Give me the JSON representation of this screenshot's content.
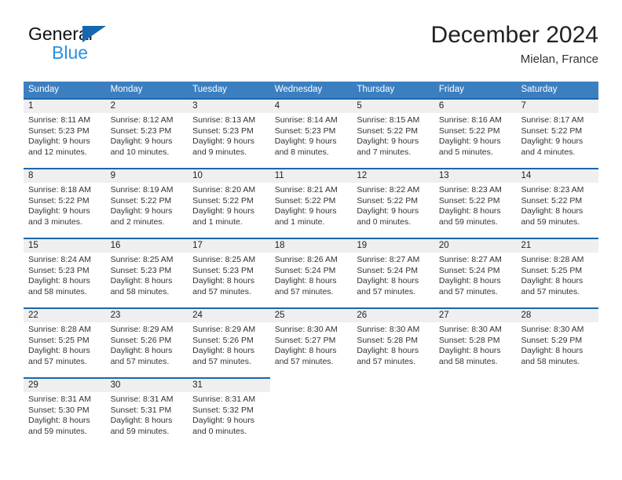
{
  "brand": {
    "line1": "General",
    "line2": "Blue",
    "triangle_color": "#1667b0",
    "blue_text_color": "#2a8fe0"
  },
  "header": {
    "title": "December 2024",
    "location": "Mielan, France"
  },
  "theme": {
    "header_bg": "#3c7fc0",
    "row_divider": "#1c66ab",
    "day_band_bg": "#efefef"
  },
  "weekdays": [
    "Sunday",
    "Monday",
    "Tuesday",
    "Wednesday",
    "Thursday",
    "Friday",
    "Saturday"
  ],
  "weeks": [
    [
      {
        "day": "1",
        "lines": [
          "Sunrise: 8:11 AM",
          "Sunset: 5:23 PM",
          "Daylight: 9 hours",
          "and 12 minutes."
        ]
      },
      {
        "day": "2",
        "lines": [
          "Sunrise: 8:12 AM",
          "Sunset: 5:23 PM",
          "Daylight: 9 hours",
          "and 10 minutes."
        ]
      },
      {
        "day": "3",
        "lines": [
          "Sunrise: 8:13 AM",
          "Sunset: 5:23 PM",
          "Daylight: 9 hours",
          "and 9 minutes."
        ]
      },
      {
        "day": "4",
        "lines": [
          "Sunrise: 8:14 AM",
          "Sunset: 5:23 PM",
          "Daylight: 9 hours",
          "and 8 minutes."
        ]
      },
      {
        "day": "5",
        "lines": [
          "Sunrise: 8:15 AM",
          "Sunset: 5:22 PM",
          "Daylight: 9 hours",
          "and 7 minutes."
        ]
      },
      {
        "day": "6",
        "lines": [
          "Sunrise: 8:16 AM",
          "Sunset: 5:22 PM",
          "Daylight: 9 hours",
          "and 5 minutes."
        ]
      },
      {
        "day": "7",
        "lines": [
          "Sunrise: 8:17 AM",
          "Sunset: 5:22 PM",
          "Daylight: 9 hours",
          "and 4 minutes."
        ]
      }
    ],
    [
      {
        "day": "8",
        "lines": [
          "Sunrise: 8:18 AM",
          "Sunset: 5:22 PM",
          "Daylight: 9 hours",
          "and 3 minutes."
        ]
      },
      {
        "day": "9",
        "lines": [
          "Sunrise: 8:19 AM",
          "Sunset: 5:22 PM",
          "Daylight: 9 hours",
          "and 2 minutes."
        ]
      },
      {
        "day": "10",
        "lines": [
          "Sunrise: 8:20 AM",
          "Sunset: 5:22 PM",
          "Daylight: 9 hours",
          "and 1 minute."
        ]
      },
      {
        "day": "11",
        "lines": [
          "Sunrise: 8:21 AM",
          "Sunset: 5:22 PM",
          "Daylight: 9 hours",
          "and 1 minute."
        ]
      },
      {
        "day": "12",
        "lines": [
          "Sunrise: 8:22 AM",
          "Sunset: 5:22 PM",
          "Daylight: 9 hours",
          "and 0 minutes."
        ]
      },
      {
        "day": "13",
        "lines": [
          "Sunrise: 8:23 AM",
          "Sunset: 5:22 PM",
          "Daylight: 8 hours",
          "and 59 minutes."
        ]
      },
      {
        "day": "14",
        "lines": [
          "Sunrise: 8:23 AM",
          "Sunset: 5:22 PM",
          "Daylight: 8 hours",
          "and 59 minutes."
        ]
      }
    ],
    [
      {
        "day": "15",
        "lines": [
          "Sunrise: 8:24 AM",
          "Sunset: 5:23 PM",
          "Daylight: 8 hours",
          "and 58 minutes."
        ]
      },
      {
        "day": "16",
        "lines": [
          "Sunrise: 8:25 AM",
          "Sunset: 5:23 PM",
          "Daylight: 8 hours",
          "and 58 minutes."
        ]
      },
      {
        "day": "17",
        "lines": [
          "Sunrise: 8:25 AM",
          "Sunset: 5:23 PM",
          "Daylight: 8 hours",
          "and 57 minutes."
        ]
      },
      {
        "day": "18",
        "lines": [
          "Sunrise: 8:26 AM",
          "Sunset: 5:24 PM",
          "Daylight: 8 hours",
          "and 57 minutes."
        ]
      },
      {
        "day": "19",
        "lines": [
          "Sunrise: 8:27 AM",
          "Sunset: 5:24 PM",
          "Daylight: 8 hours",
          "and 57 minutes."
        ]
      },
      {
        "day": "20",
        "lines": [
          "Sunrise: 8:27 AM",
          "Sunset: 5:24 PM",
          "Daylight: 8 hours",
          "and 57 minutes."
        ]
      },
      {
        "day": "21",
        "lines": [
          "Sunrise: 8:28 AM",
          "Sunset: 5:25 PM",
          "Daylight: 8 hours",
          "and 57 minutes."
        ]
      }
    ],
    [
      {
        "day": "22",
        "lines": [
          "Sunrise: 8:28 AM",
          "Sunset: 5:25 PM",
          "Daylight: 8 hours",
          "and 57 minutes."
        ]
      },
      {
        "day": "23",
        "lines": [
          "Sunrise: 8:29 AM",
          "Sunset: 5:26 PM",
          "Daylight: 8 hours",
          "and 57 minutes."
        ]
      },
      {
        "day": "24",
        "lines": [
          "Sunrise: 8:29 AM",
          "Sunset: 5:26 PM",
          "Daylight: 8 hours",
          "and 57 minutes."
        ]
      },
      {
        "day": "25",
        "lines": [
          "Sunrise: 8:30 AM",
          "Sunset: 5:27 PM",
          "Daylight: 8 hours",
          "and 57 minutes."
        ]
      },
      {
        "day": "26",
        "lines": [
          "Sunrise: 8:30 AM",
          "Sunset: 5:28 PM",
          "Daylight: 8 hours",
          "and 57 minutes."
        ]
      },
      {
        "day": "27",
        "lines": [
          "Sunrise: 8:30 AM",
          "Sunset: 5:28 PM",
          "Daylight: 8 hours",
          "and 58 minutes."
        ]
      },
      {
        "day": "28",
        "lines": [
          "Sunrise: 8:30 AM",
          "Sunset: 5:29 PM",
          "Daylight: 8 hours",
          "and 58 minutes."
        ]
      }
    ],
    [
      {
        "day": "29",
        "lines": [
          "Sunrise: 8:31 AM",
          "Sunset: 5:30 PM",
          "Daylight: 8 hours",
          "and 59 minutes."
        ]
      },
      {
        "day": "30",
        "lines": [
          "Sunrise: 8:31 AM",
          "Sunset: 5:31 PM",
          "Daylight: 8 hours",
          "and 59 minutes."
        ]
      },
      {
        "day": "31",
        "lines": [
          "Sunrise: 8:31 AM",
          "Sunset: 5:32 PM",
          "Daylight: 9 hours",
          "and 0 minutes."
        ]
      },
      {
        "day": "",
        "lines": []
      },
      {
        "day": "",
        "lines": []
      },
      {
        "day": "",
        "lines": []
      },
      {
        "day": "",
        "lines": []
      }
    ]
  ]
}
